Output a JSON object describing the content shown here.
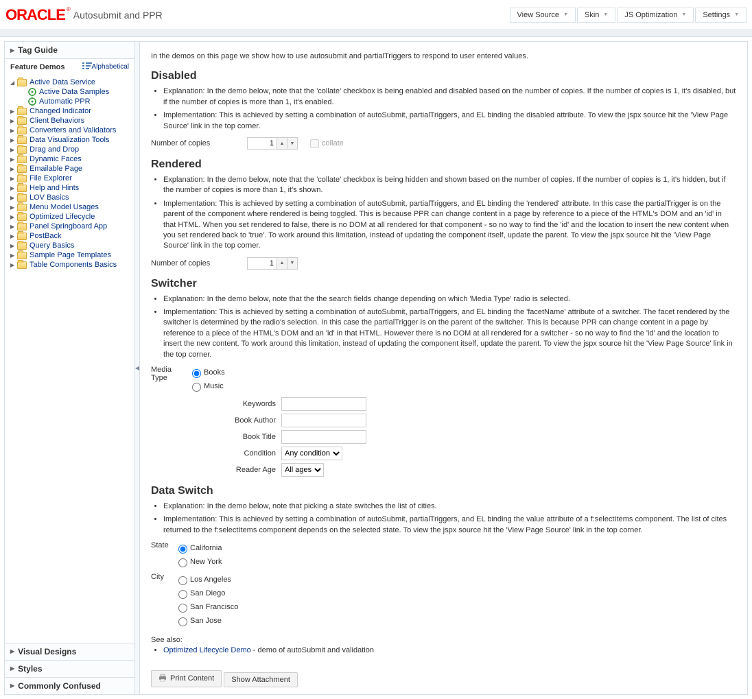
{
  "header": {
    "logo_text": "ORACLE",
    "page_title": "Autosubmit and PPR",
    "buttons": [
      "View Source",
      "Skin",
      "JS Optimization",
      "Settings"
    ]
  },
  "sidebar": {
    "tag_guide": "Tag Guide",
    "feature_demos": "Feature Demos",
    "alphabetical": "Alphabetical",
    "active_data_service": "Active Data Service",
    "active_data_samples": "Active Data Samples",
    "automatic_ppr": "Automatic PPR",
    "items": [
      "Changed Indicator",
      "Client Behaviors",
      "Converters and Validators",
      "Data Visualization Tools",
      "Drag and Drop",
      "Dynamic Faces",
      "Emailable Page",
      "File Explorer",
      "Help and Hints",
      "LOV Basics",
      "Menu Model Usages",
      "Optimized Lifecycle",
      "Panel Springboard App",
      "PostBack",
      "Query Basics",
      "Sample Page Templates",
      "Table Components Basics"
    ],
    "visual_designs": "Visual Designs",
    "styles": "Styles",
    "commonly_confused": "Commonly Confused"
  },
  "content": {
    "intro": "In the demos on this page we show how to use autosubmit and partialTriggers to respond to user entered values.",
    "disabled": {
      "title": "Disabled",
      "explanation": "Explanation: In the demo below, note that the 'collate' checkbox is being enabled and disabled based on the number of copies. If the number of copies is 1, it's disabled, but if the number of copies is more than 1, it's enabled.",
      "implementation": "Implementation: This is achieved by setting a combination of autoSubmit, partialTriggers, and EL binding the disabled attribute. To view the jspx source hit the 'View Page Source' link in the top corner.",
      "copies_label": "Number of copies",
      "copies_value": "1",
      "collate_label": "collate"
    },
    "rendered": {
      "title": "Rendered",
      "explanation": "Explanation: In the demo below, note that the 'collate' checkbox is being hidden and shown based on the number of copies. If the number of copies is 1, it's hidden, but if the number of copies is more than 1, it's shown.",
      "implementation": "Implementation: This is achieved by setting a combination of autoSubmit, partialTriggers, and EL binding the 'rendered' attribute. In this case the partialTrigger is on the parent of the component where rendered is being toggled. This is because PPR can change content in a page by reference to a piece of the HTML's DOM and an 'id' in that HTML. When you set rendered to false, there is no DOM at all rendered for that component - so no way to find the 'id' and the location to insert the new content when you set rendered back to 'true'. To work around this limitation, instead of updating the component itself, update the parent. To view the jspx source hit the 'View Page Source' link in the top corner.",
      "copies_label": "Number of copies",
      "copies_value": "1"
    },
    "switcher": {
      "title": "Switcher",
      "explanation": "Explanation: In the demo below, note that the the search fields change depending on which 'Media Type' radio is selected.",
      "implementation": "Implementation: This is achieved by setting a combination of autoSubmit, partialTriggers, and EL binding the 'facetName' attribute of a switcher. The facet rendered by the switcher is determined by the radio's selection. In this case the partialTrigger is on the parent of the switcher. This is because PPR can change content in a page by reference to a piece of the HTML's DOM and an 'id' in that HTML. However there is no DOM at all rendered for a switcher - so no way to find the 'id' and the location to insert the new content. To work around this limitation, instead of updating the component itself, update the parent. To view the jspx source hit the 'View Page Source' link in the top corner.",
      "media_type_label": "Media Type",
      "media_books": "Books",
      "media_music": "Music",
      "keywords_label": "Keywords",
      "book_author_label": "Book Author",
      "book_title_label": "Book Title",
      "condition_label": "Condition",
      "condition_value": "Any condition",
      "reader_age_label": "Reader Age",
      "reader_age_value": "All ages"
    },
    "data_switch": {
      "title": "Data Switch",
      "explanation": "Explanation: In the demo below, note that picking a state switches the list of cities.",
      "implementation": "Implementation: This is achieved by setting a combination of autoSubmit, partialTriggers, and EL binding the value attribute of a f:selectItems component. The list of cites returned to the f:selectItems component depends on the selected state. To view the jspx source hit the 'View Page Source' link in the top corner.",
      "state_label": "State",
      "state_ca": "California",
      "state_ny": "New York",
      "city_label": "City",
      "city_la": "Los Angeles",
      "city_sd": "San Diego",
      "city_sf": "San Francisco",
      "city_sj": "San Jose"
    },
    "see_also_label": "See also:",
    "see_also_link": "Optimized Lifecycle Demo",
    "see_also_desc": " - demo of autoSubmit and validation",
    "print_content": "Print Content",
    "show_attachment": "Show Attachment"
  }
}
